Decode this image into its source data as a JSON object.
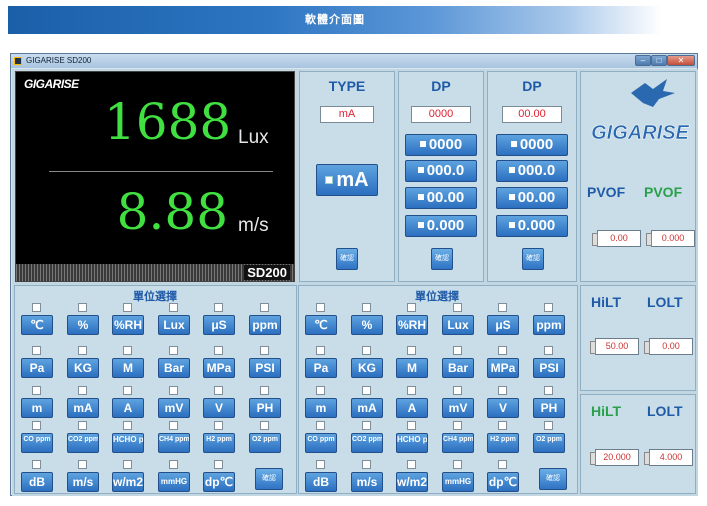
{
  "banner": {
    "title": "軟體介面圖"
  },
  "window": {
    "title": "GIGARISE    SD200",
    "minimize": "–",
    "maximize": "□",
    "close": "✕"
  },
  "display": {
    "logo": "GIGARISE",
    "value1": "1688",
    "unit1": "Lux",
    "value2": "8.88",
    "unit2": "m/s",
    "model": "SD200"
  },
  "type_panel": {
    "header": "TYPE",
    "value": "mA",
    "button": "mA",
    "confirm": "確認"
  },
  "dp1": {
    "header": "DP",
    "value": "0000",
    "options": [
      "0000",
      "000.0",
      "00.00",
      "0.000"
    ],
    "confirm": "確認"
  },
  "dp2": {
    "header": "DP",
    "value": "00.00",
    "options": [
      "0000",
      "000.0",
      "00.00",
      "0.000"
    ],
    "confirm": "確認"
  },
  "right": {
    "logo": "GIGARISE",
    "pvof_label1": "PVOF",
    "pvof_label2": "PVOF",
    "pvof_value1": "0.00",
    "pvof_value2": "0.000",
    "hilt_label": "HiLT",
    "lolt_label": "LOLT",
    "hilt_value": "50.00",
    "lolt_value": "0.00",
    "hilt_label2": "HiLT",
    "lolt_label2": "LOLT",
    "hilt_value2": "20.000",
    "lolt_value2": "4.000"
  },
  "unit_select": {
    "title": "單位選擇",
    "confirm": "確認",
    "rows": [
      [
        "℃",
        "%",
        "%RH",
        "Lux",
        "μS",
        "ppm"
      ],
      [
        "Pa",
        "KG",
        "M",
        "Bar",
        "MPa",
        "PSI"
      ],
      [
        "m",
        "mA",
        "A",
        "mV",
        "V",
        "PH"
      ],
      [
        "CO ppm",
        "CO2 ppm",
        "HCHO ppm",
        "CH4 ppm",
        "H2 ppm",
        "O2 ppm"
      ],
      [
        "dB",
        "m/s",
        "w/m2",
        "mmHG",
        "dp℃"
      ]
    ]
  },
  "colors": {
    "accent": "#2b6fc0",
    "display_value": "#3fe03f",
    "header_text": "#1f5aa8",
    "pvof_green": "#2aa04a",
    "value_red": "#d23"
  }
}
